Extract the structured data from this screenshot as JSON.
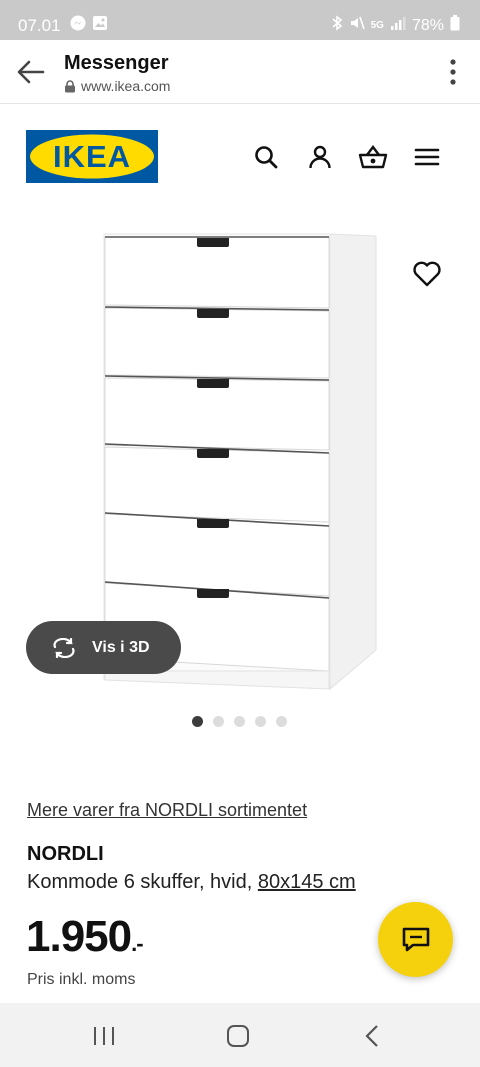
{
  "status_bar": {
    "time": "07.01",
    "battery": "78%",
    "network": "5G"
  },
  "browser": {
    "title": "Messenger",
    "url": "www.ikea.com"
  },
  "site": {
    "logo_text": "IKEA",
    "brand_colors": {
      "blue": "#0058A3",
      "yellow": "#FFDB00"
    }
  },
  "product": {
    "view_3d_label": "Vis i 3D",
    "range_link": "Mere varer fra NORDLI sortimentet",
    "name": "NORDLI",
    "description": "Kommode 6 skuffer, hvid, ",
    "dimensions": "80x145 cm",
    "price": "1.950",
    "price_suffix": ".-",
    "price_note": "Pris inkl. moms",
    "image_count": 5,
    "active_image": 1
  },
  "icons": {
    "back": "arrow-left-icon",
    "overflow": "more-vert-icon",
    "search": "search-icon",
    "account": "person-icon",
    "cart": "basket-icon",
    "menu": "hamburger-icon",
    "favourite": "heart-icon",
    "rotate": "rotate-3d-icon",
    "chat": "chat-icon"
  }
}
